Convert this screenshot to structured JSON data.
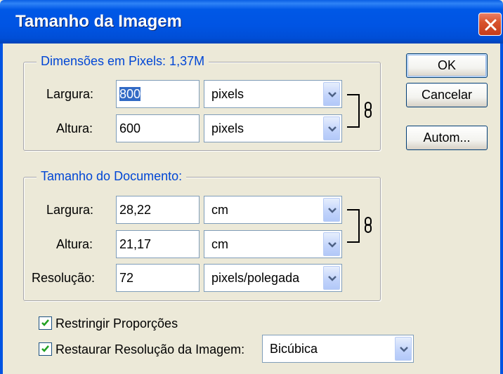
{
  "window": {
    "title": "Tamanho da Imagem"
  },
  "pixel_dimensions": {
    "legend": "Dimensões em Pixels:  1,37M",
    "width": {
      "label": "Largura:",
      "value": "800",
      "unit": "pixels"
    },
    "height": {
      "label": "Altura:",
      "value": "600",
      "unit": "pixels"
    }
  },
  "document_size": {
    "legend": "Tamanho do Documento:",
    "width": {
      "label": "Largura:",
      "value": "28,22",
      "unit": "cm"
    },
    "height": {
      "label": "Altura:",
      "value": "21,17",
      "unit": "cm"
    },
    "resolution": {
      "label": "Resolução:",
      "value": "72",
      "unit": "pixels/polegada"
    }
  },
  "buttons": {
    "ok": "OK",
    "cancel": "Cancelar",
    "auto": "Autom..."
  },
  "options": {
    "constrain_proportions": {
      "label": "Restringir Proporções",
      "checked": true
    },
    "resample_image": {
      "label": "Restaurar Resolução da Imagem:",
      "checked": true,
      "method": "Bicúbica"
    }
  },
  "icons": {
    "close": "close-icon",
    "chain": "chain-link-icon",
    "dropdown": "chevron-down-icon",
    "check": "checkmark-icon"
  },
  "colors": {
    "title_bar": "#0054e3",
    "legend_text": "#0046d5",
    "dialog_bg": "#ece9d8",
    "selection": "#316ac5"
  }
}
